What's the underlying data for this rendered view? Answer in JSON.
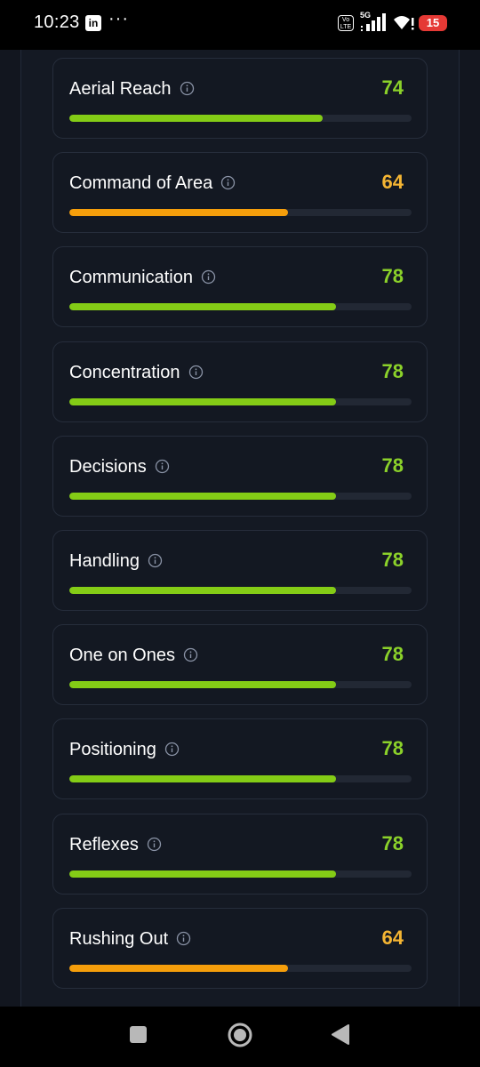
{
  "status_bar": {
    "time": "10:23",
    "app_icon": "linkedin-icon",
    "app_icon_text": "in",
    "more": "···",
    "volte": "Vo LTE",
    "network": "5G",
    "battery": "15"
  },
  "colors": {
    "high": "#84cc16",
    "mid": "#f59e0b",
    "high_text": "#8bd12a",
    "mid_text": "#f5b533"
  },
  "attributes": [
    {
      "label": "Aerial Reach",
      "value": "74",
      "level": "high"
    },
    {
      "label": "Command of Area",
      "value": "64",
      "level": "mid"
    },
    {
      "label": "Communication",
      "value": "78",
      "level": "high"
    },
    {
      "label": "Concentration",
      "value": "78",
      "level": "high"
    },
    {
      "label": "Decisions",
      "value": "78",
      "level": "high"
    },
    {
      "label": "Handling",
      "value": "78",
      "level": "high"
    },
    {
      "label": "One on Ones",
      "value": "78",
      "level": "high"
    },
    {
      "label": "Positioning",
      "value": "78",
      "level": "high"
    },
    {
      "label": "Reflexes",
      "value": "78",
      "level": "high"
    },
    {
      "label": "Rushing Out",
      "value": "64",
      "level": "mid"
    }
  ],
  "nav": {
    "recents_icon": "square-icon",
    "home_icon": "circle-icon",
    "back_icon": "triangle-back-icon"
  }
}
